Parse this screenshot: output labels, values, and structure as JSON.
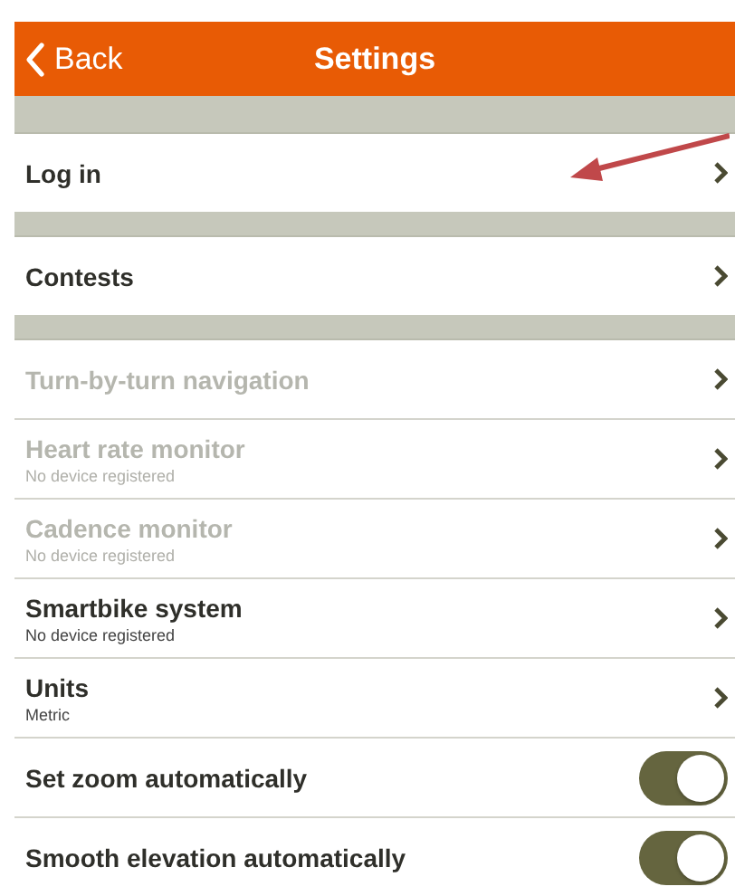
{
  "nav": {
    "back": "Back",
    "title": "Settings"
  },
  "sections": [
    {
      "rows": [
        {
          "kind": "link",
          "label": "Log in",
          "disabled": false
        }
      ]
    },
    {
      "rows": [
        {
          "kind": "link",
          "label": "Contests",
          "disabled": false
        }
      ]
    },
    {
      "rows": [
        {
          "kind": "link",
          "label": "Turn-by-turn navigation",
          "disabled": true
        },
        {
          "kind": "link",
          "label": "Heart rate monitor",
          "subtitle": "No device registered",
          "disabled": true
        },
        {
          "kind": "link",
          "label": "Cadence monitor",
          "subtitle": "No device registered",
          "disabled": true
        },
        {
          "kind": "link",
          "label": "Smartbike system",
          "subtitle": "No device registered",
          "disabled": false
        },
        {
          "kind": "link",
          "label": "Units",
          "subtitle": "Metric",
          "disabled": false
        },
        {
          "kind": "toggle",
          "label": "Set zoom automatically",
          "on": true,
          "disabled": false
        },
        {
          "kind": "toggle",
          "label": "Smooth elevation automatically",
          "on": true,
          "disabled": false
        }
      ]
    }
  ]
}
